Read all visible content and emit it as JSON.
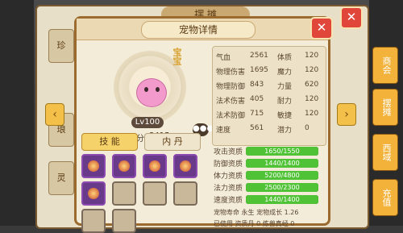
{
  "background": {
    "title": "摆 摊"
  },
  "right_tabs": [
    "商会",
    "摆摊",
    "西域",
    "充值"
  ],
  "left_tabs": [
    "珍",
    "琅",
    "灵"
  ],
  "dialog": {
    "title": "宠物详情",
    "close_label": "✕",
    "pet": {
      "name": "宝宝",
      "level": "Lv100",
      "score_label": "评分",
      "score_value": "3415",
      "chat_label": "●●●"
    },
    "stats": [
      {
        "label": "气血",
        "value": "2561",
        "label2": "体质",
        "value2": "120"
      },
      {
        "label": "物理伤害",
        "value": "1695",
        "label2": "魔力",
        "value2": "120"
      },
      {
        "label": "物理防御",
        "value": "843",
        "label2": "力量",
        "value2": "620"
      },
      {
        "label": "法术伤害",
        "value": "405",
        "label2": "耐力",
        "value2": "120"
      },
      {
        "label": "法术防御",
        "value": "715",
        "label2": "敏捷",
        "value2": "120"
      },
      {
        "label": "速度",
        "value": "561",
        "label2": "潜力",
        "value2": "0"
      }
    ],
    "tabs": {
      "skills": "技 能",
      "neidan": "内 丹"
    },
    "skill_slots_filled": 5,
    "skill_slots_total": 10,
    "aptitudes": [
      {
        "label": "攻击资质",
        "text": "1650/1550",
        "fill": 1.0
      },
      {
        "label": "防御资质",
        "text": "1440/1400",
        "fill": 1.0
      },
      {
        "label": "体力资质",
        "text": "5200/4800",
        "fill": 1.0
      },
      {
        "label": "法力资质",
        "text": "2500/2300",
        "fill": 1.0
      },
      {
        "label": "速度资质",
        "text": "1440/1400",
        "fill": 1.0
      }
    ],
    "footer": {
      "lifespan_label": "宠物寿命",
      "lifespan_value": "永生",
      "growth_label": "宠物成长",
      "growth_value": "1.26",
      "used_label": "已使用",
      "used_value_label": "资质丹",
      "used_value": "0",
      "refine_label": "炼兽真经",
      "refine_value": "0"
    }
  },
  "arrows": {
    "left": "‹",
    "right": "›"
  },
  "colors": {
    "accent": "#f3b23a",
    "close": "#e0463a",
    "bar": "#4fc236"
  }
}
